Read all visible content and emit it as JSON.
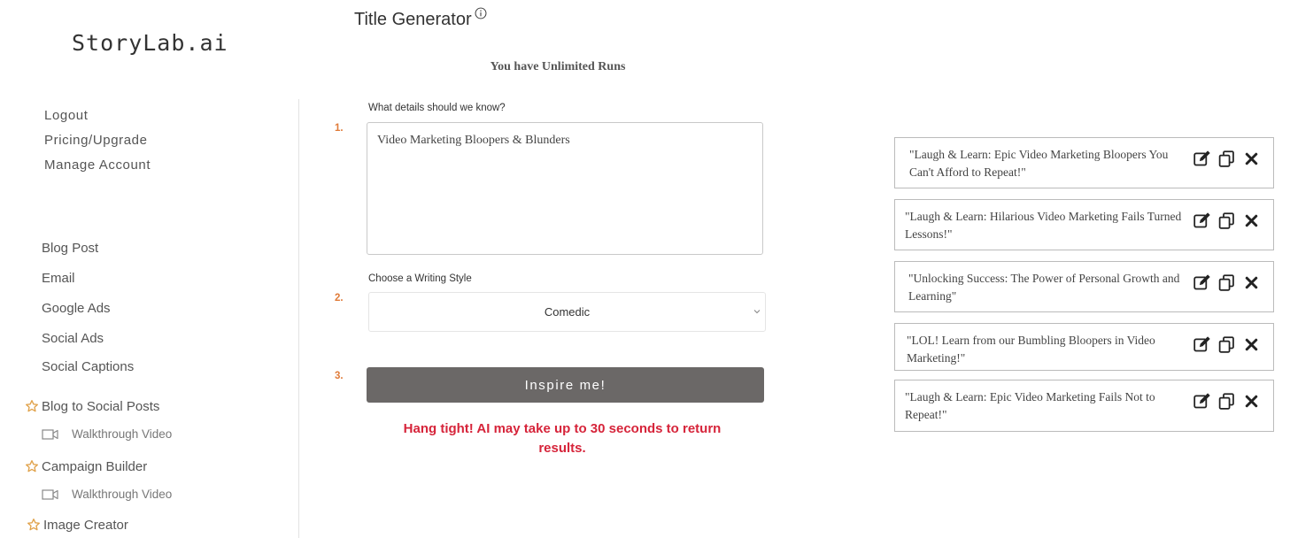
{
  "brand": {
    "logo_text": "StoryLab.ai"
  },
  "account_links": [
    {
      "label": "Logout"
    },
    {
      "label": "Pricing/Upgrade"
    },
    {
      "label": "Manage Account"
    }
  ],
  "nav_links": [
    {
      "label": "Blog Post"
    },
    {
      "label": "Email"
    },
    {
      "label": "Google Ads"
    },
    {
      "label": "Social Ads"
    },
    {
      "label": "Social Captions"
    }
  ],
  "featured_tools": [
    {
      "label": "Blog to Social Posts",
      "sub_label": "Walkthrough Video",
      "icon": "star-icon"
    },
    {
      "label": "Campaign Builder",
      "sub_label": "Walkthrough Video",
      "icon": "star-icon"
    },
    {
      "label": "Image Creator",
      "icon": "star-icon"
    }
  ],
  "main": {
    "title": "Title Generator",
    "runs_text": "You have Unlimited Runs",
    "step1": {
      "number": "1.",
      "label": "What details should we know?",
      "value": "Video Marketing Bloopers & Blunders"
    },
    "step2": {
      "number": "2.",
      "label": "Choose a Writing Style",
      "selected": "Comedic"
    },
    "step3": {
      "number": "3.",
      "button_label": "Inspire me!"
    },
    "warning": "Hang tight! AI may take up to 30 seconds to return results."
  },
  "results": [
    {
      "text": "\"Laugh & Learn: Epic Video Marketing Bloopers You Can't Afford to Repeat!\""
    },
    {
      "text": "\"Laugh & Learn: Hilarious Video Marketing Fails Turned Lessons!\""
    },
    {
      "text": "\"Unlocking Success: The Power of Personal Growth and Learning\""
    },
    {
      "text": "\"LOL! Learn from our Bumbling Bloopers in Video Marketing!\""
    },
    {
      "text": "\"Laugh & Learn: Epic Video Marketing Fails Not to Repeat!\""
    }
  ],
  "colors": {
    "accent_star": "#e0a24b",
    "step_number": "#e07b39",
    "warning": "#d6243a",
    "button_bg": "#6b6867"
  }
}
